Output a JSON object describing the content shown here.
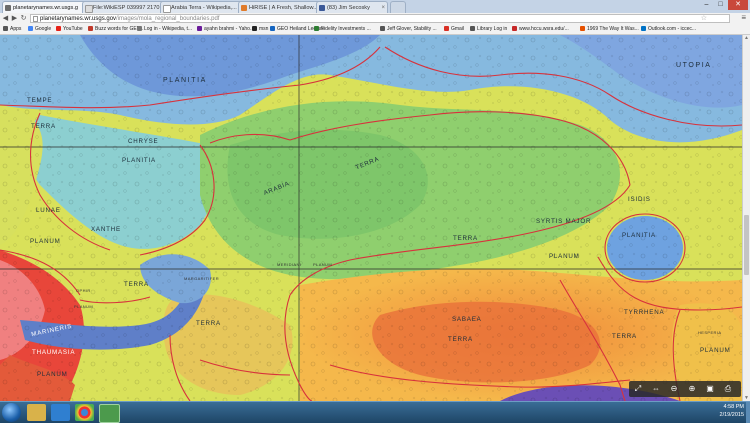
{
  "tabs": [
    {
      "title": "planetarynames.wr.usgs.g",
      "color": "#6b6b6b"
    },
    {
      "title": "File:WikiESP 039997 2170...",
      "color": "#dddddd"
    },
    {
      "title": "Arabia Terra - Wikipedia,...",
      "color": "#ffffff"
    },
    {
      "title": "HiRISE | A Fresh, Shallow...",
      "color": "#e07b2a"
    },
    {
      "title": "(83) Jim Secosky",
      "color": "#3b5998"
    }
  ],
  "window": {
    "minimize": "–",
    "maximize": "□",
    "close": "✕"
  },
  "omnibox": {
    "host": "planetarynames.wr.usgs.gov",
    "path": "/images/mola_regional_boundaries.pdf"
  },
  "bookmarks": [
    {
      "label": "Apps",
      "color": "#555"
    },
    {
      "label": "Google",
      "color": "#4285f4"
    },
    {
      "label": "YouTube",
      "color": "#e62117"
    },
    {
      "label": "Buzz words for GEP...",
      "color": "#c0392b"
    },
    {
      "label": "Log in - Wikipedia, t...",
      "color": "#777"
    },
    {
      "label": "ayahn brahmi - Yaho...",
      "color": "#6a1b9a"
    },
    {
      "label": "msn",
      "color": "#222"
    },
    {
      "label": "GEO Heiland Lecture",
      "color": "#1565c0"
    },
    {
      "label": "Fidelity Investments ...",
      "color": "#2e7d32"
    },
    {
      "label": "Jeff Glover, Stability ...",
      "color": "#555"
    },
    {
      "label": "Gmail",
      "color": "#d93025"
    },
    {
      "label": "Library Log in",
      "color": "#555"
    },
    {
      "label": "www.hccu.wsra.edu/...",
      "color": "#c62828"
    },
    {
      "label": "1969 The Way It Was...",
      "color": "#e65100"
    },
    {
      "label": "Outlook.com - iccec...",
      "color": "#0072c6"
    }
  ],
  "map_labels": {
    "planitia_top": "PLANITIA",
    "utopia": "UTOPIA",
    "tempe": "TEMPE",
    "terra_tempe": "TERRA",
    "chryse": "CHRYSE",
    "planitia_chryse": "PLANITIA",
    "terra_arabia_a": "TERRA",
    "arabia": "ARABIA",
    "lunae": "LUNAE",
    "planum_lunae": "PLANUM",
    "xanthe": "XANTHE",
    "terra_xanthe": "TERRA",
    "syrtis": "SYRTIS MAJOR",
    "terra_mid": "TERRA",
    "planum_syrtis": "PLANUM",
    "isidis": "ISIDIS",
    "planitia_isidis": "PLANITIA",
    "ophir": "OPHIR",
    "planum_ophir": "PLANUM",
    "meridiani": "MERIDIANI",
    "planum_meridiani": "PLANUM",
    "margaritifer": "MARGARITIFER",
    "terra_marg": "TERRA",
    "sabaea": "SABAEA",
    "terra_sabaea": "TERRA",
    "tyrrhena": "TYRRHENA",
    "hesperia": "HESPERIA",
    "planum_hesp": "PLANUM",
    "marineris": "MARINERIS",
    "thaumasia": "THAUMASIA",
    "planum_thaum": "PLANUM",
    "terra_lower": "TERRA"
  },
  "pdf_toolbar": [
    "fit-page",
    "fit-width",
    "zoom-out",
    "zoom-in",
    "save",
    "print"
  ],
  "taskbar": {
    "time": "4:58 PM",
    "date": "2/19/2015"
  }
}
